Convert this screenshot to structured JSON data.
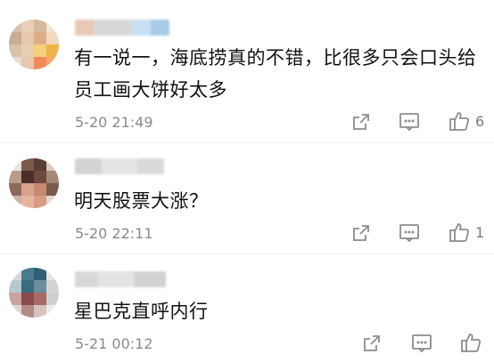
{
  "comments": [
    {
      "text": "有一说一，海底捞真的不错，比很多只会口头给员工画大饼好太多",
      "time": "5-20 21:49",
      "likes": "6",
      "icons": [
        "share-icon",
        "reply-icon",
        "thumbs-up-icon"
      ]
    },
    {
      "text": "明天股票大涨？",
      "time": "5-20 22:11",
      "likes": "1",
      "icons": [
        "share-icon",
        "reply-icon",
        "thumbs-up-icon"
      ]
    },
    {
      "text": "星巴克直呼内行",
      "time": "5-21 00:12",
      "likes": "",
      "icons": [
        "share-icon",
        "reply-icon",
        "thumbs-up-icon"
      ]
    }
  ],
  "colors": {
    "text": "#111111",
    "meta": "#8a8a8a",
    "icon": "#8c8c8c"
  }
}
